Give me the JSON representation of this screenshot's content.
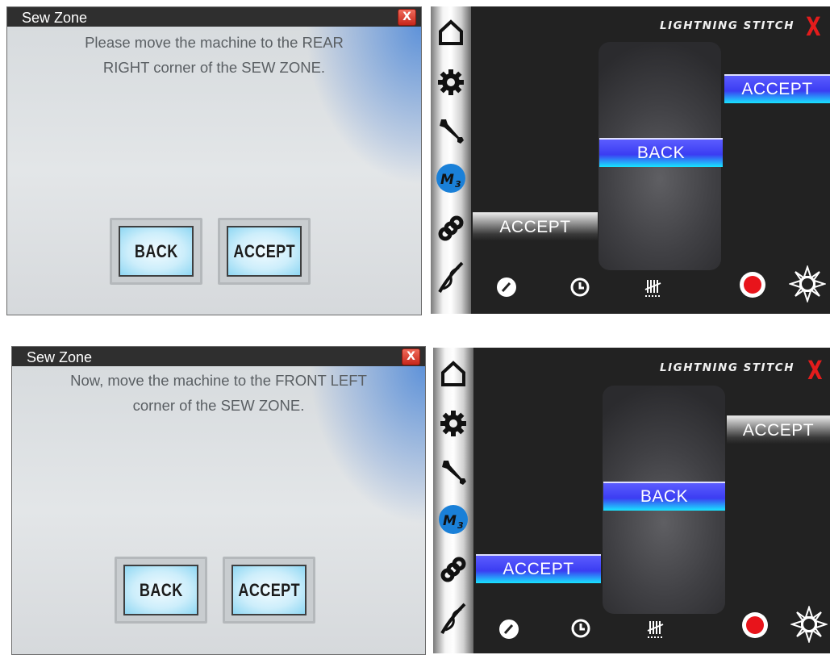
{
  "screens": [
    {
      "dialog": {
        "title": "Sew Zone",
        "close_label": "X",
        "message_lines": [
          "Please move the machine to the REAR",
          "RIGHT corner of the SEW ZONE."
        ],
        "back_label": "BACK",
        "accept_label": "ACCEPT"
      },
      "panel": {
        "brand": "LIGHTNING STITCH",
        "close_label": "X",
        "accept_right_label": "ACCEPT",
        "back_label": "BACK",
        "accept_left_label": "ACCEPT",
        "sidebar_logo_text": "M3"
      }
    },
    {
      "dialog": {
        "title": "Sew Zone",
        "close_label": "X",
        "message_lines": [
          "Now, move the machine to the FRONT LEFT",
          "corner of the SEW ZONE."
        ],
        "back_label": "BACK",
        "accept_label": "ACCEPT"
      },
      "panel": {
        "brand": "LIGHTNING STITCH",
        "close_label": "X",
        "accept_right_label": "ACCEPT",
        "back_label": "BACK",
        "accept_left_label": "ACCEPT",
        "sidebar_logo_text": "M3"
      }
    }
  ],
  "icons": {
    "sidebar": [
      "home-icon",
      "gear-icon",
      "wrench-icon",
      "m3-logo-icon",
      "chain-link-icon",
      "needle-thread-icon"
    ],
    "bottom": [
      "speedometer-icon",
      "clock-icon",
      "stitch-counter-icon",
      "record-icon",
      "brightness-icon"
    ]
  },
  "colors": {
    "accent_blue": "#3b3df2",
    "accent_cyan": "#19e5ff",
    "brand_red": "#e31c1c",
    "record_red": "#e8141b",
    "panel_bg": "#222222"
  }
}
